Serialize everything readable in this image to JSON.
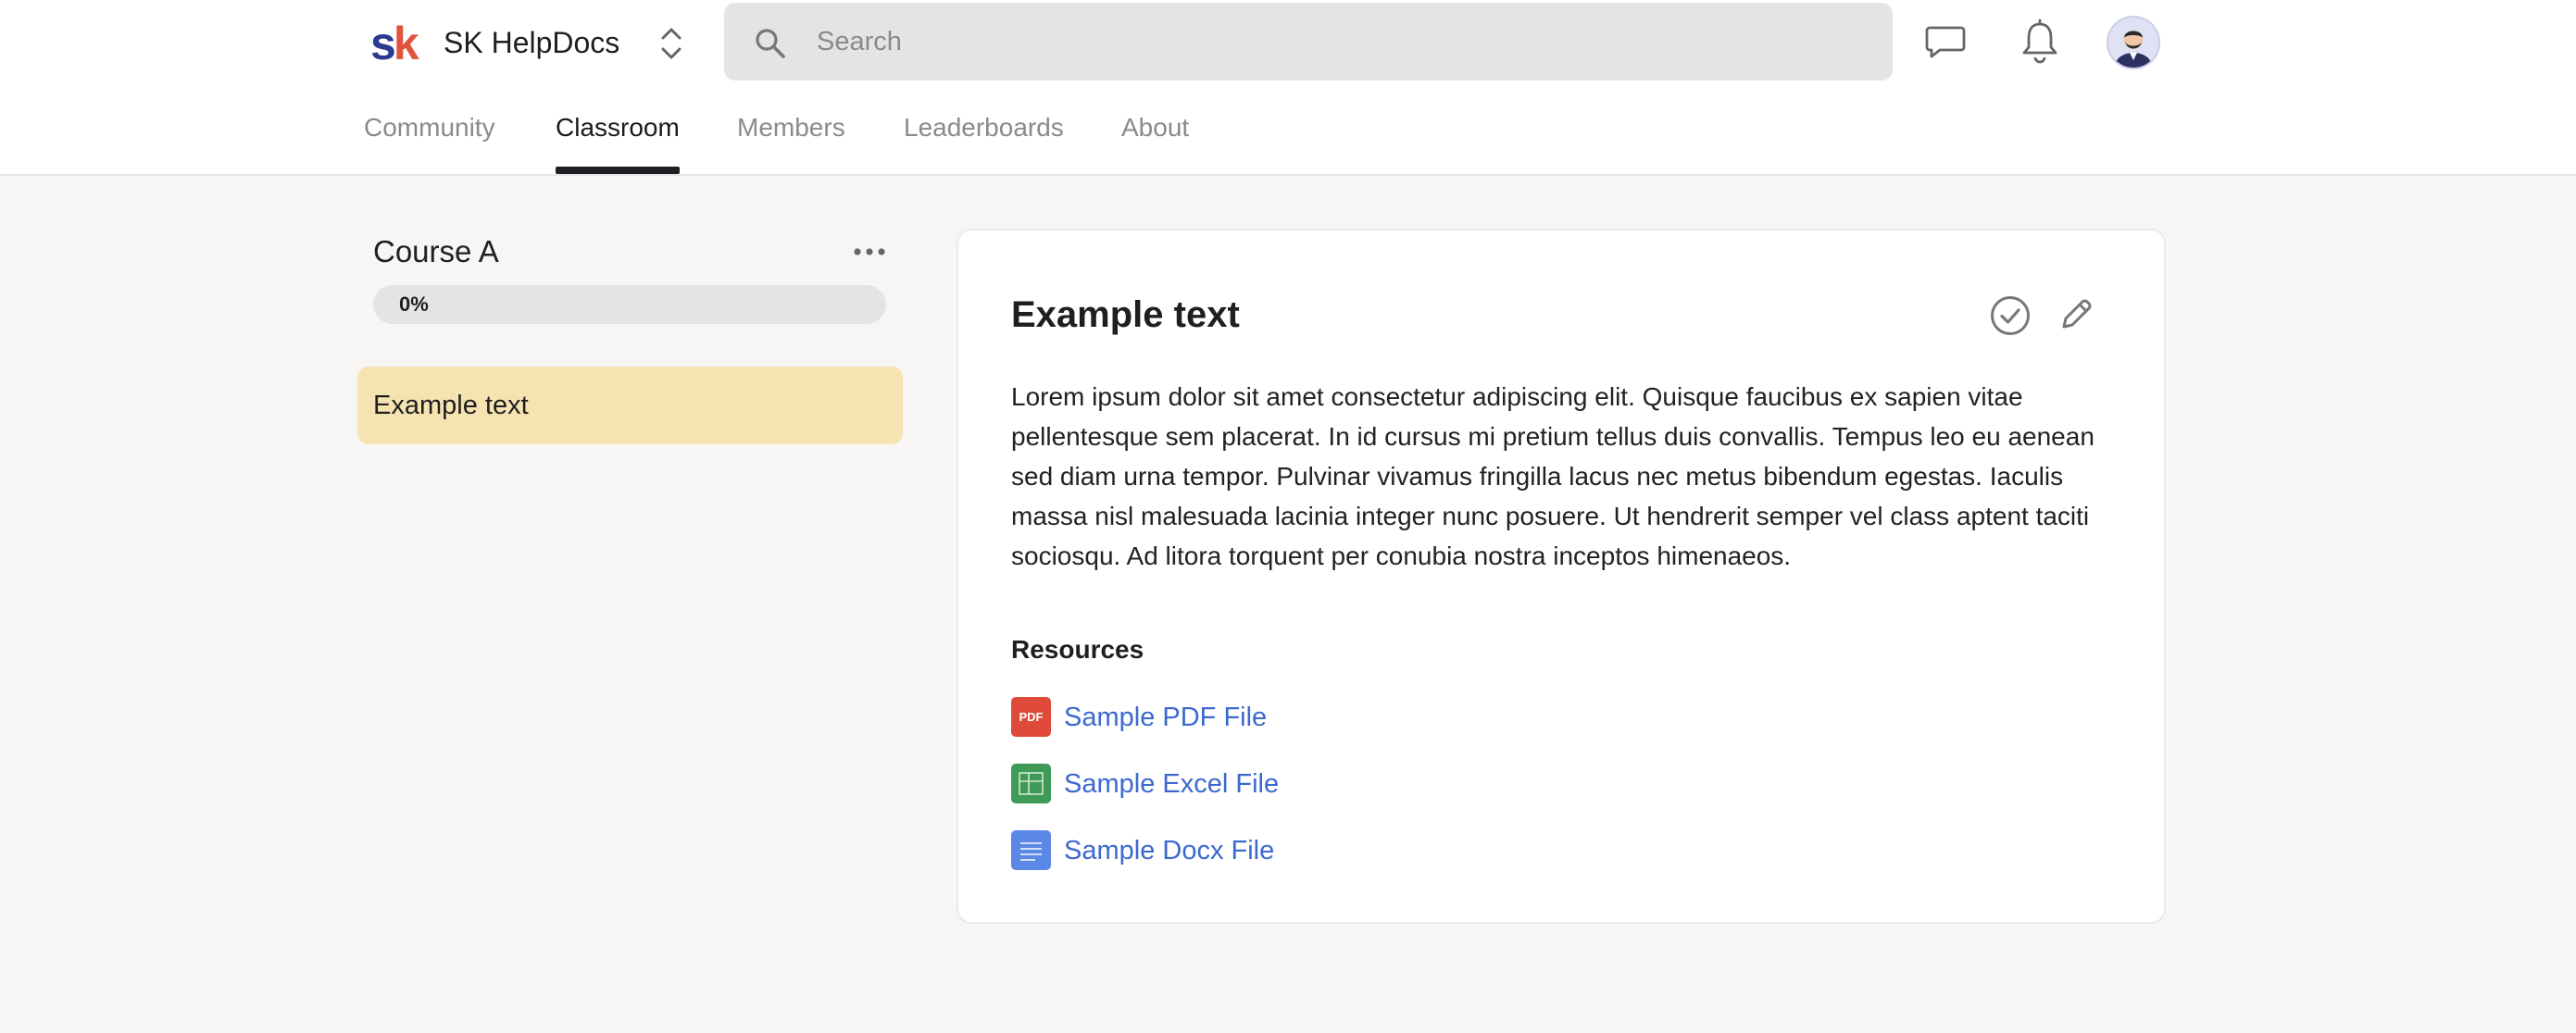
{
  "app": {
    "logo_text_s": "s",
    "logo_text_k": "k",
    "name": "SK HelpDocs"
  },
  "search": {
    "placeholder": "Search"
  },
  "header_icons": [
    "chat-icon",
    "bell-icon",
    "avatar"
  ],
  "nav": {
    "tabs": [
      {
        "label": "Community",
        "active": false
      },
      {
        "label": "Classroom",
        "active": true
      },
      {
        "label": "Members",
        "active": false
      },
      {
        "label": "Leaderboards",
        "active": false
      },
      {
        "label": "About",
        "active": false
      }
    ]
  },
  "sidebar": {
    "course_title": "Course A",
    "progress_percent": 0,
    "progress_label": "0%",
    "lessons": [
      {
        "title": "Example text",
        "selected": true
      }
    ]
  },
  "lesson": {
    "title": "Example text",
    "body": "Lorem ipsum dolor sit amet consectetur adipiscing elit. Quisque faucibus ex sapien vitae pellentesque sem placerat. In id cursus mi pretium tellus duis convallis. Tempus leo eu aenean sed diam urna tempor. Pulvinar vivamus fringilla lacus nec metus bibendum egestas. Iaculis massa nisl malesuada lacinia integer nunc posuere. Ut hendrerit semper vel class aptent taciti sociosqu. Ad litora torquent per conubia nostra inceptos himenaeos.",
    "resources_heading": "Resources",
    "resources": [
      {
        "label": "Sample PDF File",
        "icon": "pdf-file-icon",
        "icon_text": "PDF",
        "color": "#df4a3a"
      },
      {
        "label": "Sample Excel File",
        "icon": "excel-file-icon",
        "color": "#3f9a57"
      },
      {
        "label": "Sample Docx File",
        "icon": "docx-file-icon",
        "color": "#5b87e6"
      }
    ]
  },
  "colors": {
    "accent_highlight": "#f5e3b2",
    "link": "#3b69cf",
    "page_background": "#f7f6f4"
  }
}
